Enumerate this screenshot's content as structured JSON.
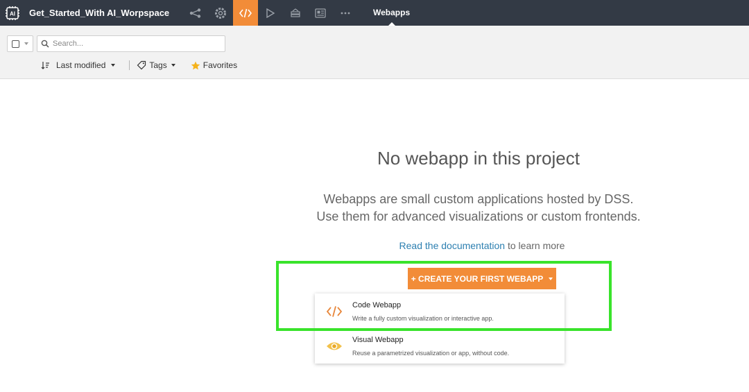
{
  "header": {
    "logo_text": "AI",
    "project_name": "Get_Started_With AI_Worpspace",
    "nav_icons": [
      "flow-icon",
      "settings-gear-icon",
      "code-icon",
      "play-icon",
      "stack-icon",
      "dashboard-icon",
      "more-dots-icon"
    ],
    "active_icon": "code-icon",
    "section_title": "Webapps"
  },
  "filters": {
    "search_placeholder": "Search...",
    "sort_label": "Last modified",
    "tags_label": "Tags",
    "favorites_label": "Favorites"
  },
  "empty_state": {
    "title": "No webapp in this project",
    "description_line1": "Webapps are small custom applications hosted by DSS.",
    "description_line2": "Use them for advanced visualizations or custom frontends.",
    "doc_link": "Read the documentation",
    "doc_suffix": " to learn more",
    "create_button": "+ CREATE YOUR FIRST WEBAPP"
  },
  "dropdown": {
    "items": [
      {
        "title": "Code Webapp",
        "description": "Write a fully custom visualization or interactive app.",
        "icon": "code-icon"
      },
      {
        "title": "Visual Webapp",
        "description": "Reuse a parametrized visualization or app, without code.",
        "icon": "eye-icon"
      }
    ]
  },
  "colors": {
    "topbar": "#333a45",
    "accent": "#f28c38",
    "highlight": "#39e32b",
    "link": "#2c7fb0"
  }
}
